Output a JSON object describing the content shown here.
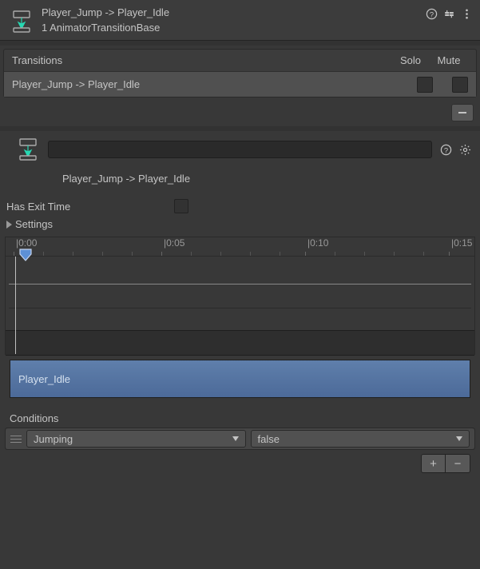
{
  "header": {
    "title": "Player_Jump -> Player_Idle",
    "subtitle": "1 AnimatorTransitionBase"
  },
  "transitions": {
    "label": "Transitions",
    "solo_label": "Solo",
    "mute_label": "Mute",
    "rows": [
      {
        "label": "Player_Jump -> Player_Idle",
        "solo": false,
        "mute": false
      }
    ]
  },
  "detail": {
    "name_value": "",
    "subtitle": "Player_Jump -> Player_Idle"
  },
  "has_exit_time": {
    "label": "Has Exit Time",
    "value": false
  },
  "settings_label": "Settings",
  "timeline": {
    "ticks": [
      {
        "label": "|0:00",
        "pos": 10
      },
      {
        "label": "|0:05",
        "pos": 198
      },
      {
        "label": "|0:10",
        "pos": 378
      },
      {
        "label": "|0:15",
        "pos": 558
      }
    ],
    "clip_label": "Player_Idle"
  },
  "conditions": {
    "label": "Conditions",
    "rows": [
      {
        "param": "Jumping",
        "value": "false"
      }
    ]
  }
}
